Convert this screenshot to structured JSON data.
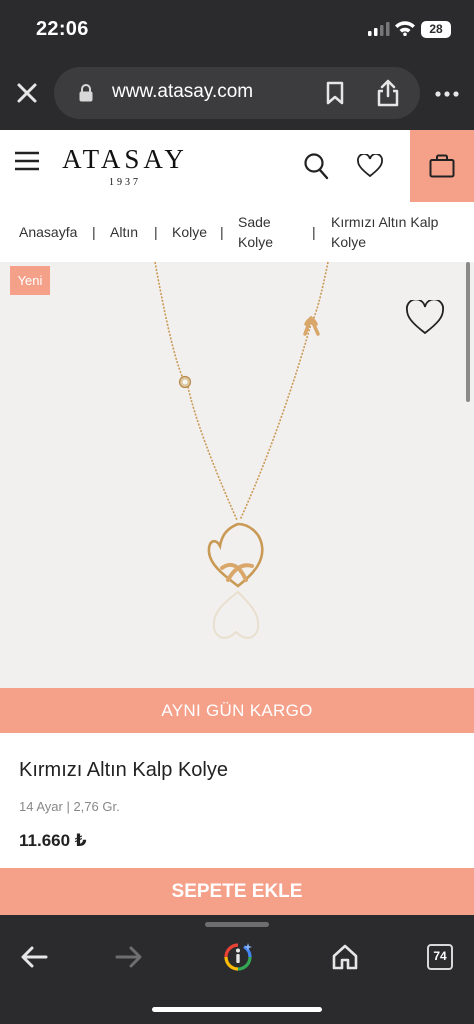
{
  "status_bar": {
    "time": "22:06",
    "battery": "28"
  },
  "browser": {
    "url": "www.atasay.com",
    "tab_count": "74"
  },
  "header": {
    "logo_text": "ATASAY",
    "logo_year": "1937",
    "icons": [
      "menu-icon",
      "search-icon",
      "heart-icon",
      "bag-icon"
    ]
  },
  "breadcrumb": {
    "items": [
      "Anasayfa",
      "Altın",
      "Kolye",
      "Sade Kolye",
      "Kırmızı Altın Kalp Kolye"
    ],
    "separator": "|"
  },
  "product": {
    "badge": "Yeni",
    "shipping_banner": "AYNI GÜN KARGO",
    "title": "Kırmızı Altın Kalp Kolye",
    "spec": "14 Ayar | 2,76 Gr.",
    "price": "11.660 ₺",
    "add_to_cart": "SEPETE EKLE"
  },
  "colors": {
    "accent": "#f5a089",
    "dark_chrome": "#2b2b2d",
    "image_bg": "#f2f0ef",
    "gold": "#c99a55"
  }
}
